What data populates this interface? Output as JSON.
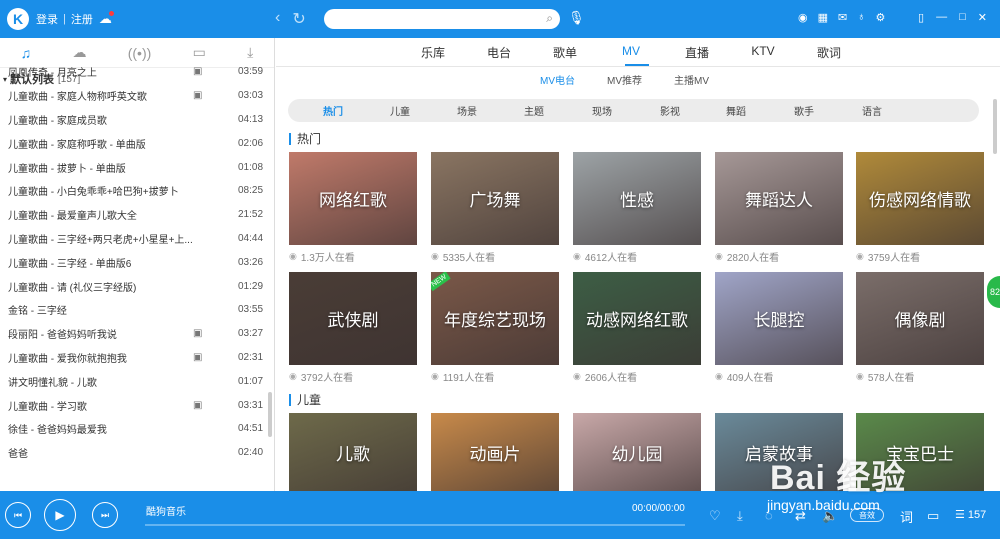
{
  "titlebar": {
    "logo": "K",
    "login": "登录",
    "separator": "|",
    "register": "注册",
    "icons": [
      "cloud-icon",
      "back-icon",
      "refresh-icon",
      "search-icon",
      "mic-icon",
      "radio-icon",
      "grid-icon",
      "mail-icon",
      "shirt-icon",
      "gear-icon",
      "mini-mode-icon",
      "minimize-icon",
      "maximize-icon",
      "close-icon"
    ]
  },
  "sidebar": {
    "tabs": [
      "music-icon",
      "cloud-icon",
      "radio-icon",
      "device-icon",
      "download-icon"
    ],
    "list_title": "默认列表",
    "list_count": "[157]",
    "songs": [
      {
        "title": "凤凰传奇 - 月亮之上",
        "mv": true,
        "duration": "03:59"
      },
      {
        "title": "儿童歌曲 - 家庭人物称呼英文歌",
        "mv": true,
        "duration": "03:03"
      },
      {
        "title": "儿童歌曲 - 家庭成员歌",
        "mv": false,
        "duration": "04:13"
      },
      {
        "title": "儿童歌曲 - 家庭称呼歌 - 单曲版",
        "mv": false,
        "duration": "02:06"
      },
      {
        "title": "儿童歌曲 - 拔萝卜 - 单曲版",
        "mv": false,
        "duration": "01:08"
      },
      {
        "title": "儿童歌曲 - 小白兔乖乖+哈巴狗+拔萝卜",
        "mv": false,
        "duration": "08:25"
      },
      {
        "title": "儿童歌曲 - 最爱童声儿歌大全",
        "mv": false,
        "duration": "21:52"
      },
      {
        "title": "儿童歌曲 - 三字经+两只老虎+小星星+上...",
        "mv": false,
        "duration": "04:44"
      },
      {
        "title": "儿童歌曲 - 三字经 - 单曲版6",
        "mv": false,
        "duration": "03:26"
      },
      {
        "title": "儿童歌曲 - 请 (礼仪三字经版)",
        "mv": false,
        "duration": "01:29"
      },
      {
        "title": "金铭 - 三字经",
        "mv": false,
        "duration": "03:55"
      },
      {
        "title": "段丽阳 - 爸爸妈妈听我说",
        "mv": true,
        "duration": "03:27"
      },
      {
        "title": "儿童歌曲 - 爱我你就抱抱我",
        "mv": true,
        "duration": "02:31"
      },
      {
        "title": "讲文明懂礼貌 - 儿歌",
        "mv": false,
        "duration": "01:07"
      },
      {
        "title": "儿童歌曲 - 学习歌",
        "mv": true,
        "duration": "03:31"
      },
      {
        "title": "徐佳 - 爸爸妈妈最爱我",
        "mv": false,
        "duration": "04:51"
      },
      {
        "title": "爸爸",
        "mv": false,
        "duration": "02:40"
      }
    ]
  },
  "main": {
    "topnav": [
      "乐库",
      "电台",
      "歌单",
      "MV",
      "直播",
      "KTV",
      "歌词"
    ],
    "topnav_active": "MV",
    "subnav": [
      "MV电台",
      "MV推荐",
      "主播MV"
    ],
    "subnav_active": "MV电台",
    "categories": [
      "热门",
      "儿童",
      "场景",
      "主题",
      "现场",
      "影视",
      "舞蹈",
      "歌手",
      "语言"
    ],
    "category_active": "热门",
    "sections": [
      {
        "title": "热门",
        "cards": [
          {
            "label": "网络红歌",
            "views": "1.3万人在看",
            "bg": "#c07a6a"
          },
          {
            "label": "广场舞",
            "views": "5335人在看",
            "bg": "#8a7562"
          },
          {
            "label": "性感",
            "views": "4612人在看",
            "bg": "#9da3a6"
          },
          {
            "label": "舞蹈达人",
            "views": "2820人在看",
            "bg": "#a69897"
          },
          {
            "label": "伤感网络情歌",
            "views": "3759人在看",
            "bg": "#b08a3a"
          },
          {
            "label": "武侠剧",
            "views": "3792人在看",
            "bg": "#4a3d36"
          },
          {
            "label": "年度综艺现场",
            "views": "1191人在看",
            "bg": "#7a5848",
            "badge": "NEW"
          },
          {
            "label": "动感网络红歌",
            "views": "2606人在看",
            "bg": "#3d5e45"
          },
          {
            "label": "长腿控",
            "views": "409人在看",
            "bg": "#a0a5c8"
          },
          {
            "label": "偶像剧",
            "views": "578人在看",
            "bg": "#7b6e6a"
          }
        ]
      },
      {
        "title": "儿童",
        "cards": [
          {
            "label": "儿歌",
            "views": "",
            "bg": "#6e6a4a"
          },
          {
            "label": "动画片",
            "views": "",
            "bg": "#c88a4a"
          },
          {
            "label": "幼儿园",
            "views": "",
            "bg": "#c8a8a8"
          },
          {
            "label": "启蒙故事",
            "views": "",
            "bg": "#6a8a9a"
          },
          {
            "label": "宝宝巴士",
            "views": "",
            "bg": "#5a8a4a"
          }
        ]
      }
    ],
    "side_float": "82"
  },
  "player": {
    "now_playing": "酷狗音乐",
    "time": "00:00/00:00",
    "quality": "音效",
    "lyric": "词",
    "playlist_count": "157",
    "icons": [
      "prev-icon",
      "play-icon",
      "next-icon",
      "like-icon",
      "download-icon",
      "share-icon",
      "loop-icon",
      "volume-icon",
      "lyric-icon",
      "comment-icon",
      "playlist-icon"
    ]
  },
  "watermark": {
    "text": "Bai 经验",
    "url": "jingyan.baidu.com"
  }
}
